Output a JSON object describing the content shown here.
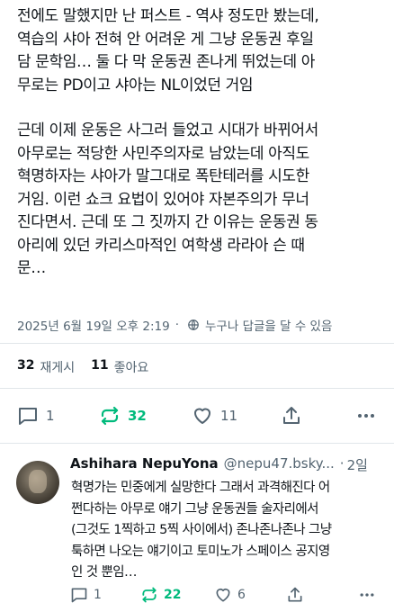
{
  "post": {
    "paragraph1": "전에도 말했지만 난 퍼스트 - 역샤 정도만 봤는데,\n역습의 샤아 전혀 안 어려운 게 그냥 운동권 후일\n담 문학임… 둘 다 막 운동권 존나게 뛰었는데 아\n무로는 PD이고  샤아는 NL이었던 거임",
    "paragraph2": "근데 이제 운동은 사그러 들었고 시대가 바뀌어서\n아무로는 적당한 사민주의자로 남았는데 아직도\n혁명하자는 샤아가 말그대로 폭탄테러를 시도한\n거임. 이런 쇼크 요법이 있어야 자본주의가 무너\n진다면서. 근데 또 그 짓까지 간 이유는 운동권 동\n아리에 있던 카리스마적인 여학생 라라아 슨 때\n문…",
    "timestamp": "2025년 6월 19일 오후 2:19",
    "separator": "·",
    "reply_permission": "누구나 답글을 달 수 있음"
  },
  "stats": {
    "reposts_count": "32",
    "reposts_label": "재게시",
    "likes_count": "11",
    "likes_label": "좋아요"
  },
  "actions": {
    "reply_count": "1",
    "repost_count": "32",
    "like_count": "11"
  },
  "reply": {
    "display_name": "Ashihara NepuYona",
    "handle": "@nepu47.bsky...",
    "separator": "·",
    "time": "2일",
    "text": "혁명가는 민중에게 실망한다 그래서 과격해진다 어\n쩐다하는 아무로 얘기 그냥 운동권들 술자리에서\n(그것도 1찍하고 5찍 사이에서) 존나존나존나 그냥\n툭하면 나오는 얘기이고 토미노가 스페이스 공지영\n인 것 뿐임…",
    "reply_count": "1",
    "repost_count": "22",
    "like_count": "6"
  },
  "colors": {
    "text": "#0f1419",
    "muted": "#536471",
    "repost_active": "#00ba7c",
    "divider": "#e1e6ea"
  }
}
